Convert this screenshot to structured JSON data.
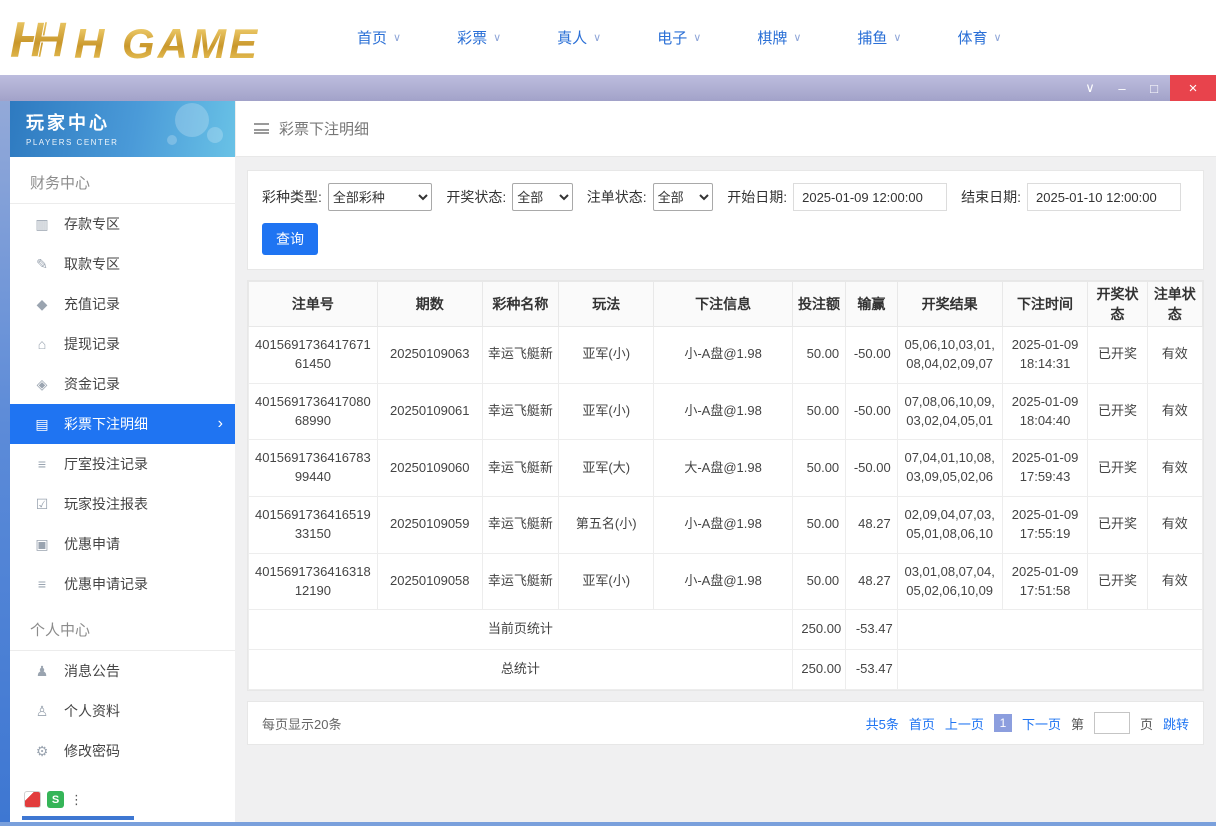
{
  "colors": {
    "accent": "#1f74f2",
    "close_red": "#e8434c",
    "gold": "#d7a433",
    "sidebar_active": "#1f74f2"
  },
  "icons": {
    "chevron_down": "∨",
    "arrow_right": "›",
    "win_minimize": "–",
    "win_maximize": "□",
    "win_close": "×",
    "more_dots": "⋮"
  },
  "top_nav": {
    "logo_text": "H GAME",
    "items": [
      {
        "label": "首页"
      },
      {
        "label": "彩票"
      },
      {
        "label": "真人"
      },
      {
        "label": "电子"
      },
      {
        "label": "棋牌"
      },
      {
        "label": "捕鱼"
      },
      {
        "label": "体育"
      }
    ]
  },
  "tray": {
    "sogou_letter": "S"
  },
  "sidebar": {
    "title": "玩家中心",
    "subtitle": "PLAYERS CENTER",
    "sections": [
      {
        "label": "财务中心",
        "items": [
          {
            "label": "存款专区",
            "icon": "▥"
          },
          {
            "label": "取款专区",
            "icon": "✎"
          },
          {
            "label": "充值记录",
            "icon": "◆"
          },
          {
            "label": "提现记录",
            "icon": "⌂"
          },
          {
            "label": "资金记录",
            "icon": "◈"
          },
          {
            "label": "彩票下注明细",
            "icon": "▤"
          },
          {
            "label": "厅室投注记录",
            "icon": "≡"
          },
          {
            "label": "玩家投注报表",
            "icon": "☑"
          },
          {
            "label": "优惠申请",
            "icon": "▣"
          },
          {
            "label": "优惠申请记录",
            "icon": "≡"
          }
        ]
      },
      {
        "label": "个人中心",
        "items": [
          {
            "label": "消息公告",
            "icon": "♟"
          },
          {
            "label": "个人资料",
            "icon": "♙"
          },
          {
            "label": "修改密码",
            "icon": "⚙"
          }
        ]
      }
    ]
  },
  "main": {
    "page_title": "彩票下注明细",
    "filters": {
      "lottery_type": {
        "label": "彩种类型:",
        "value": "全部彩种"
      },
      "draw_status": {
        "label": "开奖状态:",
        "value": "全部"
      },
      "order_status": {
        "label": "注单状态:",
        "value": "全部"
      },
      "start_date": {
        "label": "开始日期:",
        "value": "2025-01-09 12:00:00"
      },
      "end_date": {
        "label": "结束日期:",
        "value": "2025-01-10 12:00:00"
      }
    },
    "search_button": "查询",
    "table": {
      "headers": [
        "注单号",
        "期数",
        "彩种名称",
        "玩法",
        "下注信息",
        "投注额",
        "输赢",
        "开奖结果",
        "下注时间",
        "开奖状态",
        "注单状态"
      ],
      "rows": [
        {
          "bet_id": "401569173641767161450",
          "period": "20250109063",
          "lottery": "幸运飞艇新",
          "play": "亚军(小)",
          "bet_info": "小-A盘@1.98",
          "amount": "50.00",
          "winloss": "-50.00",
          "result": "05,06,10,03,01,08,04,02,09,07",
          "time": "2025-01-09 18:14:31",
          "draw_status": "已开奖",
          "order_status": "有效"
        },
        {
          "bet_id": "401569173641708068990",
          "period": "20250109061",
          "lottery": "幸运飞艇新",
          "play": "亚军(小)",
          "bet_info": "小-A盘@1.98",
          "amount": "50.00",
          "winloss": "-50.00",
          "result": "07,08,06,10,09,03,02,04,05,01",
          "time": "2025-01-09 18:04:40",
          "draw_status": "已开奖",
          "order_status": "有效"
        },
        {
          "bet_id": "401569173641678399440",
          "period": "20250109060",
          "lottery": "幸运飞艇新",
          "play": "亚军(大)",
          "bet_info": "大-A盘@1.98",
          "amount": "50.00",
          "winloss": "-50.00",
          "result": "07,04,01,10,08,03,09,05,02,06",
          "time": "2025-01-09 17:59:43",
          "draw_status": "已开奖",
          "order_status": "有效"
        },
        {
          "bet_id": "401569173641651933150",
          "period": "20250109059",
          "lottery": "幸运飞艇新",
          "play": "第五名(小)",
          "bet_info": "小-A盘@1.98",
          "amount": "50.00",
          "winloss": "48.27",
          "result": "02,09,04,07,03,05,01,08,06,10",
          "time": "2025-01-09 17:55:19",
          "draw_status": "已开奖",
          "order_status": "有效"
        },
        {
          "bet_id": "401569173641631812190",
          "period": "20250109058",
          "lottery": "幸运飞艇新",
          "play": "亚军(小)",
          "bet_info": "小-A盘@1.98",
          "amount": "50.00",
          "winloss": "48.27",
          "result": "03,01,08,07,04,05,02,06,10,09",
          "time": "2025-01-09 17:51:58",
          "draw_status": "已开奖",
          "order_status": "有效"
        }
      ],
      "summary": [
        {
          "label": "当前页统计",
          "amount": "250.00",
          "winloss": "-53.47"
        },
        {
          "label": "总统计",
          "amount": "250.00",
          "winloss": "-53.47"
        }
      ]
    },
    "pagination": {
      "page_size_text": "每页显示20条",
      "total_text": "共5条",
      "first": "首页",
      "prev": "上一页",
      "current": "1",
      "next": "下一页",
      "jump_label_pre": "第",
      "jump_label_post": "页",
      "jump_action": "跳转"
    }
  }
}
